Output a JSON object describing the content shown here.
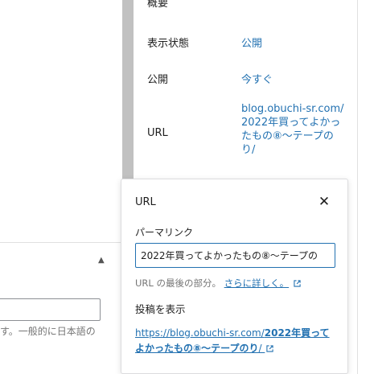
{
  "sidebar": {
    "panel_title": "概要",
    "rows": [
      {
        "label": "表示状態",
        "value": "公開"
      },
      {
        "label": "公開",
        "value": "今すぐ"
      },
      {
        "label": "URL",
        "value": "blog.obuchi-sr.com/2022年買ってよかったもの⑧〜テープのり/"
      }
    ]
  },
  "editor": {
    "help_text": "す。一般的に日本語の"
  },
  "popover": {
    "title": "URL",
    "close_icon": "close-icon",
    "permalink_label": "パーマリンク",
    "slug_value": "2022年買ってよかったもの⑧〜テープの",
    "help_prefix": "URL の最後の部分。",
    "help_link": "さらに詳しく。",
    "view_post_label": "投稿を表示",
    "view_post_url_prefix": "https://blog.obuchi-sr.com/",
    "view_post_url_bold": "2022年買ってよかったもの⑧〜テープのり",
    "view_post_url_suffix": "/"
  },
  "colors": {
    "accent": "#2271b1",
    "text": "#1e1e1e",
    "muted": "#757575",
    "border": "#dcdcde"
  }
}
